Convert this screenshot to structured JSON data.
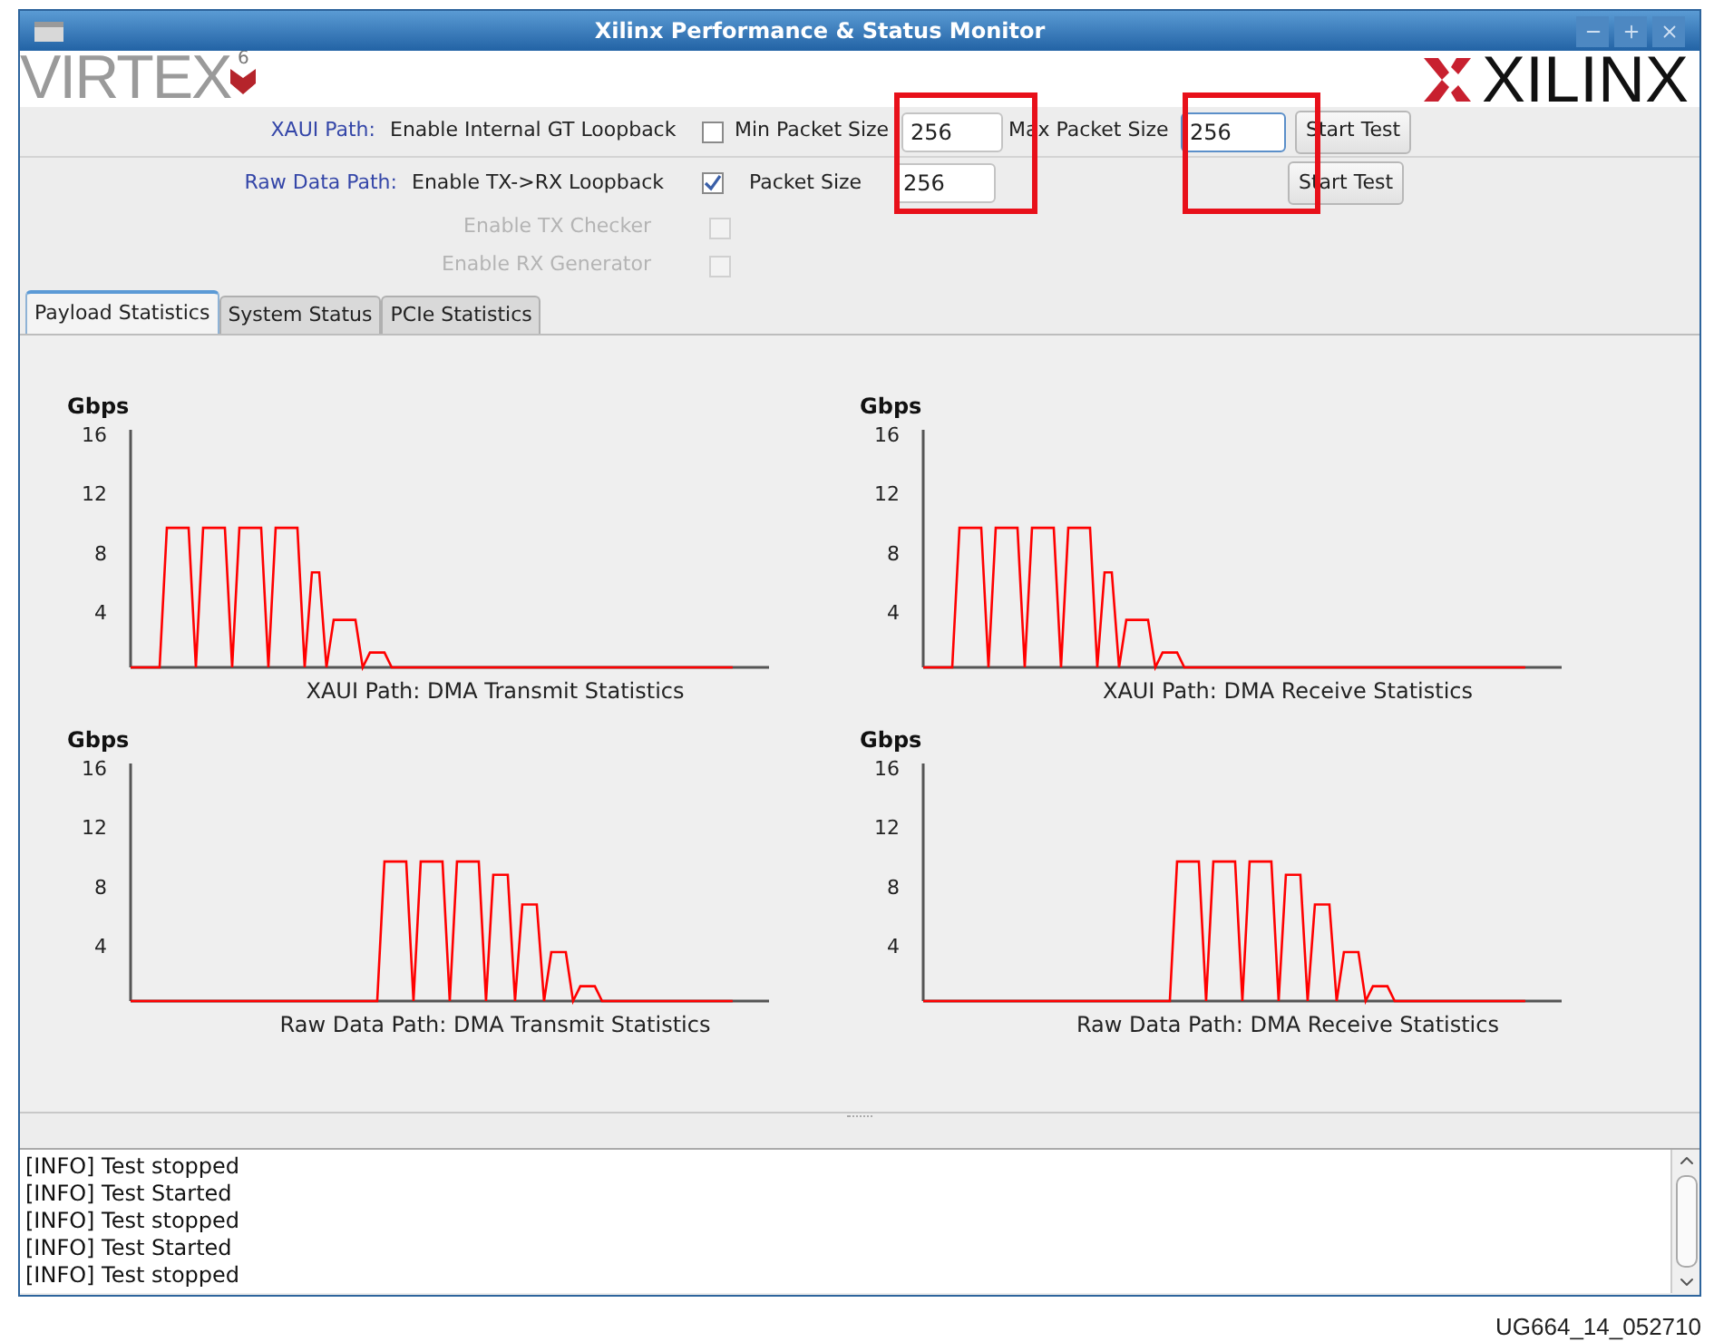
{
  "window": {
    "title": "Xilinx Performance & Status Monitor"
  },
  "logos": {
    "left": {
      "text": "VIRTEX",
      "superscript": "6"
    },
    "right": {
      "text": "XILINX"
    }
  },
  "xaui_path": {
    "label": "XAUI Path:",
    "loopback": {
      "label": "Enable Internal GT Loopback",
      "checked": false
    },
    "min_packet_size": {
      "label": "Min Packet Size",
      "value": "256",
      "focused": false
    },
    "max_packet_size": {
      "label": "Max Packet Size",
      "value": "256",
      "focused": true
    },
    "button": "Start Test"
  },
  "raw_data_path": {
    "label": "Raw Data Path:",
    "loopback": {
      "label": "Enable TX->RX Loopback",
      "checked": true
    },
    "packet_size": {
      "label": "Packet Size",
      "value": "256",
      "focused": false
    },
    "options": [
      {
        "label": "Enable TX Checker",
        "checked": false,
        "disabled": true
      },
      {
        "label": "Enable RX Generator",
        "checked": false,
        "disabled": true
      }
    ],
    "button": "Start Test"
  },
  "tabs": [
    {
      "label": "Payload Statistics",
      "selected": true
    },
    {
      "label": "System Status",
      "selected": false
    },
    {
      "label": "PCIe Statistics",
      "selected": false
    }
  ],
  "charts": [
    {
      "chart_data": {
        "type": "line",
        "title": "XAUI Path: DMA Transmit Statistics",
        "ylabel": "Gbps",
        "ylim": [
          0,
          16
        ],
        "yticks": [
          4,
          8,
          12,
          16
        ],
        "categories": [
          null,
          null,
          null,
          null,
          null,
          null,
          null,
          null,
          null,
          null,
          null,
          null,
          null,
          null,
          null,
          null,
          null,
          null,
          null,
          null,
          null,
          null,
          null,
          null,
          null,
          null,
          null,
          null,
          null,
          null,
          null,
          null,
          null,
          null,
          null,
          null,
          null,
          null,
          null,
          null,
          null,
          null,
          null,
          null,
          null,
          null,
          null,
          null,
          null,
          null,
          null,
          null,
          null,
          null,
          null,
          null,
          null,
          null,
          null,
          null,
          null,
          null,
          null,
          null,
          null,
          null,
          null,
          null,
          null,
          null,
          null,
          null,
          null,
          null,
          null,
          null,
          null,
          null,
          null,
          null,
          null,
          null,
          null,
          null
        ],
        "series": [
          {
            "color": "#ff0000",
            "values": [
              0,
              0,
              0,
              0,
              0,
              9.4,
              9.4,
              9.4,
              9.4,
              0,
              9.4,
              9.4,
              9.4,
              9.4,
              0,
              9.4,
              9.4,
              9.4,
              9.4,
              0,
              9.4,
              9.4,
              9.4,
              9.4,
              0,
              6.4,
              6.4,
              0,
              3.2,
              3.2,
              3.2,
              3.2,
              0,
              1,
              1,
              1,
              0,
              0,
              0,
              0,
              0,
              0,
              0,
              0,
              0,
              0,
              0,
              0,
              0,
              0,
              0,
              0,
              0,
              0,
              0,
              0,
              0,
              0,
              0,
              0,
              0,
              0,
              0,
              0,
              0,
              0,
              0,
              0,
              0,
              0,
              0,
              0,
              0,
              0,
              0,
              0,
              0,
              0,
              0,
              0,
              0,
              0,
              0,
              0
            ]
          }
        ]
      }
    },
    {
      "chart_data": {
        "type": "line",
        "title": "XAUI Path: DMA Receive Statistics",
        "ylabel": "Gbps",
        "ylim": [
          0,
          16
        ],
        "yticks": [
          4,
          8,
          12,
          16
        ],
        "categories": [
          null,
          null,
          null,
          null,
          null,
          null,
          null,
          null,
          null,
          null,
          null,
          null,
          null,
          null,
          null,
          null,
          null,
          null,
          null,
          null,
          null,
          null,
          null,
          null,
          null,
          null,
          null,
          null,
          null,
          null,
          null,
          null,
          null,
          null,
          null,
          null,
          null,
          null,
          null,
          null,
          null,
          null,
          null,
          null,
          null,
          null,
          null,
          null,
          null,
          null,
          null,
          null,
          null,
          null,
          null,
          null,
          null,
          null,
          null,
          null,
          null,
          null,
          null,
          null,
          null,
          null,
          null,
          null,
          null,
          null,
          null,
          null,
          null,
          null,
          null,
          null,
          null,
          null,
          null,
          null,
          null,
          null,
          null,
          null
        ],
        "series": [
          {
            "color": "#ff0000",
            "values": [
              0,
              0,
              0,
              0,
              0,
              9.4,
              9.4,
              9.4,
              9.4,
              0,
              9.4,
              9.4,
              9.4,
              9.4,
              0,
              9.4,
              9.4,
              9.4,
              9.4,
              0,
              9.4,
              9.4,
              9.4,
              9.4,
              0,
              6.4,
              6.4,
              0,
              3.2,
              3.2,
              3.2,
              3.2,
              0,
              1,
              1,
              1,
              0,
              0,
              0,
              0,
              0,
              0,
              0,
              0,
              0,
              0,
              0,
              0,
              0,
              0,
              0,
              0,
              0,
              0,
              0,
              0,
              0,
              0,
              0,
              0,
              0,
              0,
              0,
              0,
              0,
              0,
              0,
              0,
              0,
              0,
              0,
              0,
              0,
              0,
              0,
              0,
              0,
              0,
              0,
              0,
              0,
              0,
              0,
              0
            ]
          }
        ]
      }
    },
    {
      "chart_data": {
        "type": "line",
        "title": "Raw Data Path: DMA Transmit Statistics",
        "ylabel": "Gbps",
        "ylim": [
          0,
          16
        ],
        "yticks": [
          4,
          8,
          12,
          16
        ],
        "categories": [
          null,
          null,
          null,
          null,
          null,
          null,
          null,
          null,
          null,
          null,
          null,
          null,
          null,
          null,
          null,
          null,
          null,
          null,
          null,
          null,
          null,
          null,
          null,
          null,
          null,
          null,
          null,
          null,
          null,
          null,
          null,
          null,
          null,
          null,
          null,
          null,
          null,
          null,
          null,
          null,
          null,
          null,
          null,
          null,
          null,
          null,
          null,
          null,
          null,
          null,
          null,
          null,
          null,
          null,
          null,
          null,
          null,
          null,
          null,
          null,
          null,
          null,
          null,
          null,
          null,
          null,
          null,
          null,
          null,
          null,
          null,
          null,
          null,
          null,
          null,
          null,
          null,
          null,
          null,
          null,
          null,
          null,
          null,
          null
        ],
        "series": [
          {
            "color": "#ff0000",
            "values": [
              0,
              0,
              0,
              0,
              0,
              0,
              0,
              0,
              0,
              0,
              0,
              0,
              0,
              0,
              0,
              0,
              0,
              0,
              0,
              0,
              0,
              0,
              0,
              0,
              0,
              0,
              0,
              0,
              0,
              0,
              0,
              0,
              0,
              0,
              0,
              9.4,
              9.4,
              9.4,
              9.4,
              0,
              9.4,
              9.4,
              9.4,
              9.4,
              0,
              9.4,
              9.4,
              9.4,
              9.4,
              0,
              8.5,
              8.5,
              8.5,
              0,
              6.5,
              6.5,
              6.5,
              0,
              3.3,
              3.3,
              3.3,
              0,
              1,
              1,
              1,
              0,
              0,
              0,
              0,
              0,
              0,
              0,
              0,
              0,
              0,
              0,
              0,
              0,
              0,
              0,
              0,
              0,
              0,
              0
            ]
          }
        ]
      }
    },
    {
      "chart_data": {
        "type": "line",
        "title": "Raw Data Path: DMA Receive Statistics",
        "ylabel": "Gbps",
        "ylim": [
          0,
          16
        ],
        "yticks": [
          4,
          8,
          12,
          16
        ],
        "categories": [
          null,
          null,
          null,
          null,
          null,
          null,
          null,
          null,
          null,
          null,
          null,
          null,
          null,
          null,
          null,
          null,
          null,
          null,
          null,
          null,
          null,
          null,
          null,
          null,
          null,
          null,
          null,
          null,
          null,
          null,
          null,
          null,
          null,
          null,
          null,
          null,
          null,
          null,
          null,
          null,
          null,
          null,
          null,
          null,
          null,
          null,
          null,
          null,
          null,
          null,
          null,
          null,
          null,
          null,
          null,
          null,
          null,
          null,
          null,
          null,
          null,
          null,
          null,
          null,
          null,
          null,
          null,
          null,
          null,
          null,
          null,
          null,
          null,
          null,
          null,
          null,
          null,
          null,
          null,
          null,
          null,
          null,
          null,
          null
        ],
        "series": [
          {
            "color": "#ff0000",
            "values": [
              0,
              0,
              0,
              0,
              0,
              0,
              0,
              0,
              0,
              0,
              0,
              0,
              0,
              0,
              0,
              0,
              0,
              0,
              0,
              0,
              0,
              0,
              0,
              0,
              0,
              0,
              0,
              0,
              0,
              0,
              0,
              0,
              0,
              0,
              0,
              9.4,
              9.4,
              9.4,
              9.4,
              0,
              9.4,
              9.4,
              9.4,
              9.4,
              0,
              9.4,
              9.4,
              9.4,
              9.4,
              0,
              8.5,
              8.5,
              8.5,
              0,
              6.5,
              6.5,
              6.5,
              0,
              3.3,
              3.3,
              3.3,
              0,
              1,
              1,
              1,
              0,
              0,
              0,
              0,
              0,
              0,
              0,
              0,
              0,
              0,
              0,
              0,
              0,
              0,
              0,
              0,
              0,
              0,
              0
            ]
          }
        ]
      }
    }
  ],
  "log": [
    "[INFO] Test stopped",
    "[INFO] Test Started",
    "[INFO] Test stopped",
    "[INFO] Test Started",
    "[INFO] Test stopped"
  ],
  "figure_id": "UG664_14_052710"
}
